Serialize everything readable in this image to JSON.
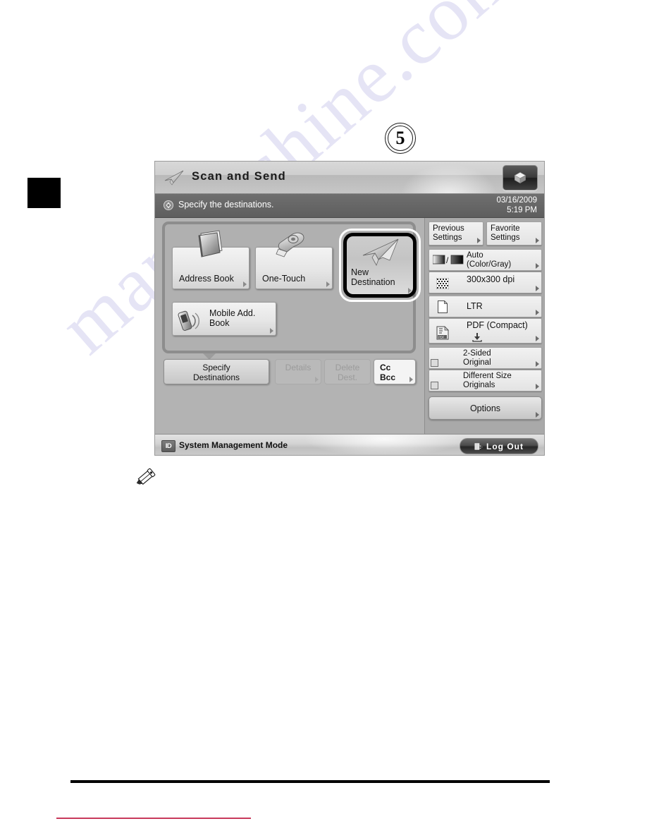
{
  "page": {
    "step_number": "5",
    "watermark": "manualshine.com",
    "note_icon": "pencil-icon"
  },
  "device": {
    "titlebar": {
      "icon": "paper-plane-icon",
      "title": "Scan and Send",
      "right_button_icon": "cube-icon"
    },
    "messagebar": {
      "icon": "status-indicator-icon",
      "message": "Specify the destinations.",
      "date": "03/16/2009",
      "time": "5:19 PM"
    },
    "destinations": {
      "buttons": [
        {
          "label_line1": "Address Book",
          "label_line2": "",
          "icon": "address-book-icon",
          "selected": false
        },
        {
          "label_line1": "One-Touch",
          "label_line2": "",
          "icon": "one-touch-icon",
          "selected": false
        },
        {
          "label_line1": "New",
          "label_line2": "Destination",
          "icon": "new-destination-plane-icon",
          "selected": true
        },
        {
          "label_line1": "Mobile Add.",
          "label_line2": "Book",
          "icon": "mobile-address-book-icon",
          "selected": false
        }
      ]
    },
    "actions": [
      {
        "line1": "Specify",
        "line2": "Destinations",
        "state": "enabled"
      },
      {
        "line1": "Details",
        "line2": "",
        "state": "disabled"
      },
      {
        "line1": "Delete",
        "line2": "Dest.",
        "state": "disabled"
      },
      {
        "line1": "Cc",
        "line2": "Bcc",
        "state": "enabled"
      }
    ],
    "settings": {
      "top_row": [
        {
          "line1": "Previous",
          "line2": "Settings"
        },
        {
          "line1": "Favorite",
          "line2": "Settings"
        }
      ],
      "items": [
        {
          "line1": "Auto",
          "line2": "(Color/Gray)",
          "icon": "color-mode-icon"
        },
        {
          "line1": "300x300 dpi",
          "line2": "",
          "icon": "resolution-halftone-icon"
        },
        {
          "line1": "LTR",
          "line2": "",
          "icon": "paper-size-icon"
        },
        {
          "line1": "PDF (Compact)",
          "line2": "",
          "icon": "pdf-file-icon"
        },
        {
          "line1": "2-Sided",
          "line2": "Original",
          "icon": "two-sided-original-icon"
        },
        {
          "line1": "Different Size",
          "line2": "Originals",
          "icon": "different-size-originals-icon"
        }
      ],
      "options_label": "Options"
    },
    "statusbar": {
      "id_badge": "ID",
      "mode_text": "System Management Mode",
      "logout_label": "Log Out",
      "logout_icon": "logout-icon"
    }
  },
  "colors": {
    "highlight_ring": "#000000",
    "rule_black": "#000000",
    "rule_red": "#c8395b",
    "watermark": "#6b63c8"
  }
}
